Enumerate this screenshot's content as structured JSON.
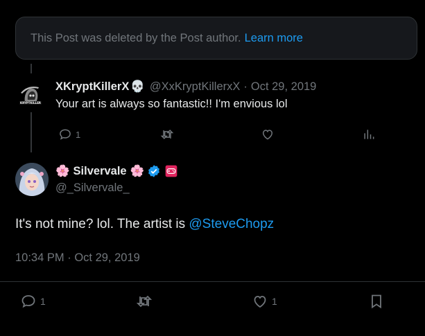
{
  "deleted_notice": {
    "text": "This Post was deleted by the Post author.",
    "link": "Learn more"
  },
  "reply": {
    "name": "XKryptKillerX",
    "name_emoji": "💀",
    "handle": "@XxKryptKillerxX",
    "separator": "·",
    "date": "Oct 29, 2019",
    "text": "Your art is always so fantastic!! I'm envious lol",
    "reply_count": "1",
    "avatar_label": "KRYPTKILLER"
  },
  "post": {
    "name": "Silvervale",
    "name_prefix_emoji": "🌸",
    "name_suffix_emoji": "🌸",
    "handle": "@_Silvervale_",
    "text_prefix": "It's not mine? lol. The artist is ",
    "mention": "@SteveChopz",
    "time": "10:34 PM",
    "separator": "·",
    "date": "Oct 29, 2019",
    "reply_count": "1",
    "like_count": "1"
  },
  "colors": {
    "background": "#000000",
    "text": "#e7e9ea",
    "muted": "#71767b",
    "accent": "#1d9bf0",
    "verified": "#1d9bf0",
    "badge_red": "#e0245e"
  },
  "icons": {
    "reply": "reply-icon",
    "repost": "repost-icon",
    "like": "heart-icon",
    "views": "views-icon",
    "bookmark": "bookmark-icon",
    "verified": "verified-badge-icon",
    "game": "gamepad-badge-icon"
  }
}
